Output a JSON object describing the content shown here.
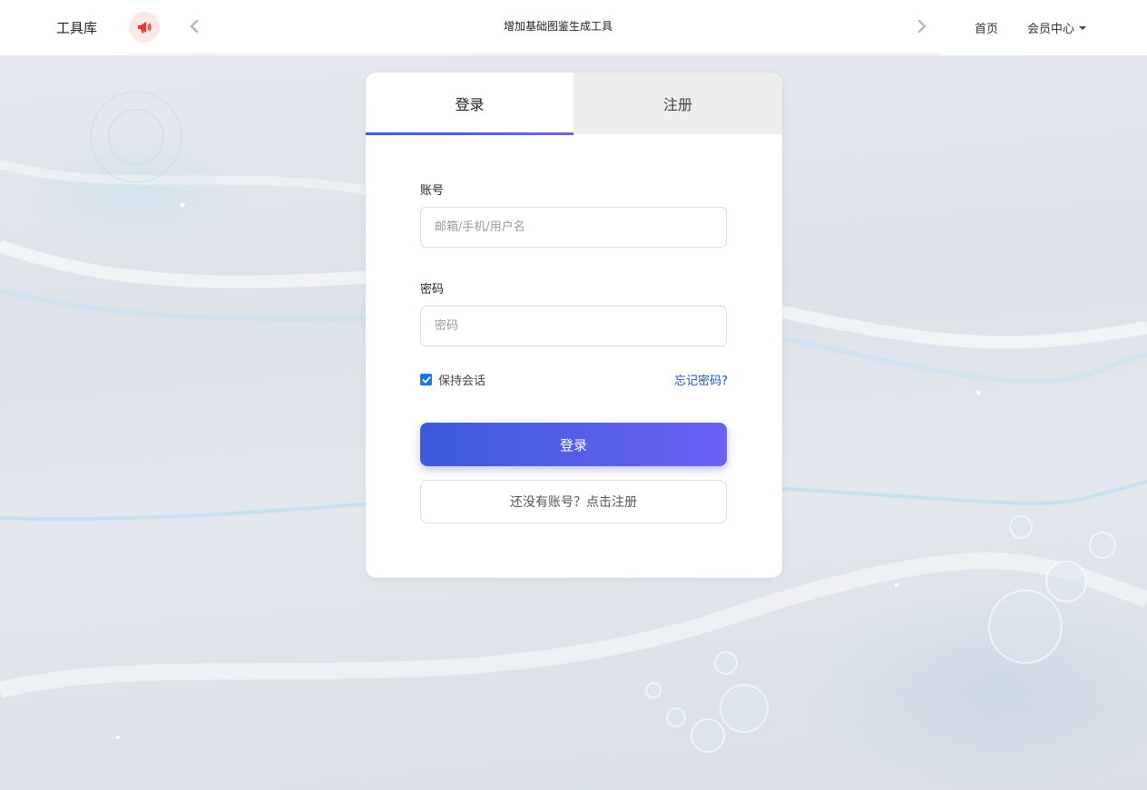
{
  "header": {
    "logo": "工具库",
    "announcement": "增加基础图鉴生成工具",
    "nav_home": "首页",
    "nav_member": "会员中心"
  },
  "tabs": {
    "login": "登录",
    "register": "注册",
    "active": "login"
  },
  "form": {
    "account_label": "账号",
    "account_placeholder": "邮箱/手机/用户名",
    "account_value": "",
    "password_label": "密码",
    "password_placeholder": "密码",
    "password_value": "",
    "remember_label": "保持会话",
    "remember_checked": true,
    "forgot_link": "忘记密码?",
    "login_button": "登录",
    "register_button": "还没有账号？点击注册"
  },
  "colors": {
    "accent_start": "#3b5bdb",
    "accent_end": "#6b62f5",
    "link": "#2154b8",
    "announce_icon": "#e53935"
  },
  "icons": {
    "announce": "megaphone-icon",
    "prev": "chevron-left-icon",
    "next": "chevron-right-icon",
    "dropdown": "caret-down-icon",
    "checkbox": "check-icon"
  }
}
